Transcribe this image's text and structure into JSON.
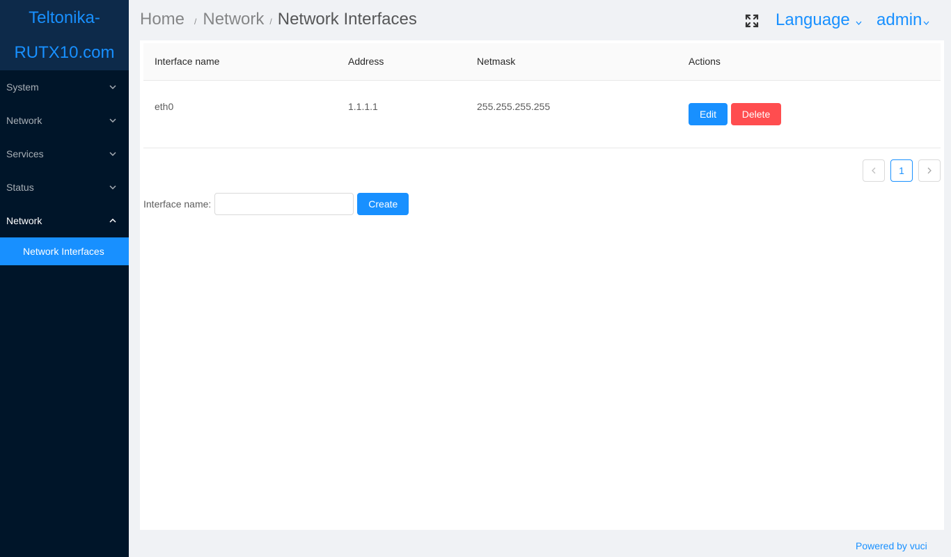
{
  "logo": {
    "line1": "Teltonika-",
    "line2": "RUTX10.com"
  },
  "sidebar": {
    "items": [
      {
        "label": "System"
      },
      {
        "label": "Network"
      },
      {
        "label": "Services"
      },
      {
        "label": "Status"
      },
      {
        "label": "Network"
      }
    ],
    "submenu": {
      "label": "Network Interfaces"
    }
  },
  "header": {
    "breadcrumb": [
      "Home",
      "Network",
      "Network Interfaces"
    ],
    "separator": "/",
    "language": "Language",
    "user": "admin"
  },
  "table": {
    "columns": [
      "Interface name",
      "Address",
      "Netmask",
      "Actions"
    ],
    "rows": [
      {
        "name": "eth0",
        "address": "1.1.1.1",
        "netmask": "255.255.255.255"
      }
    ],
    "edit_label": "Edit",
    "delete_label": "Delete"
  },
  "pagination": {
    "current": "1",
    "prev": "<",
    "next": ">"
  },
  "create": {
    "label": "Interface name:",
    "value": "",
    "button": "Create"
  },
  "footer": {
    "text": "Powered by vuci"
  },
  "colors": {
    "primary": "#1890ff",
    "danger": "#ff4d4f",
    "sidebar_bg": "#001529"
  },
  "icons": {
    "fullscreen": "fullscreen-icon",
    "chevron": "chevron-down-icon"
  }
}
